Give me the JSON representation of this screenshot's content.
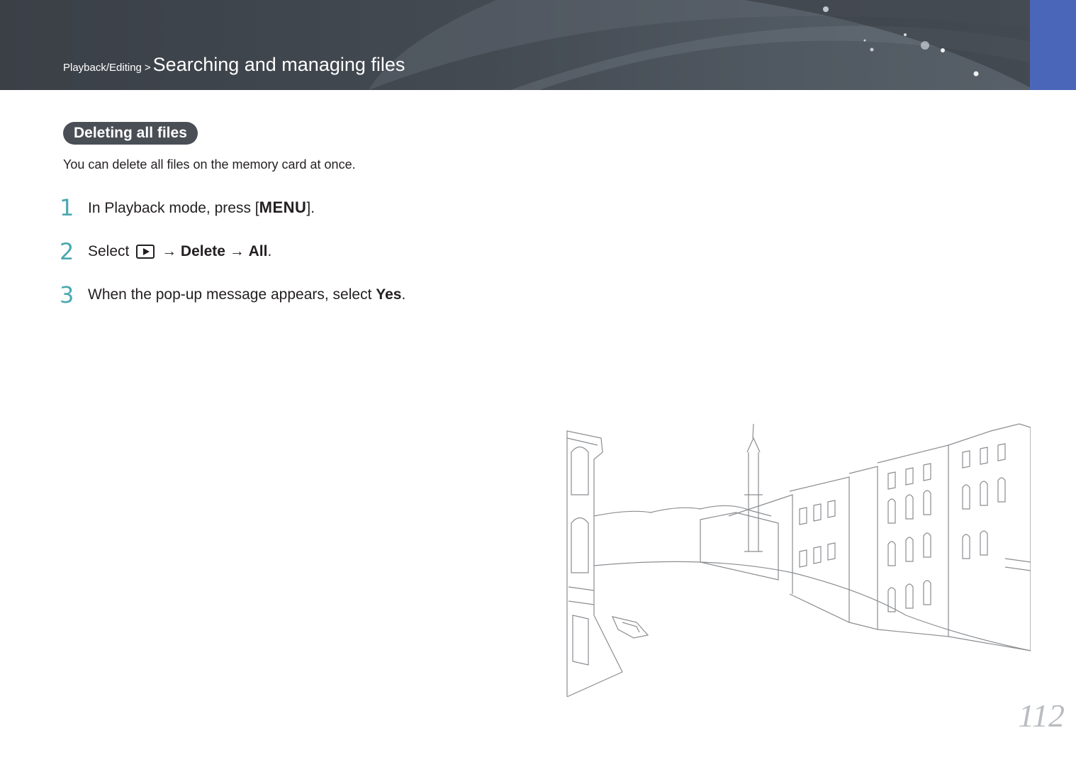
{
  "header": {
    "breadcrumb_parent": "Playback/Editing",
    "separator": ">",
    "breadcrumb_current": "Searching and managing files"
  },
  "section": {
    "title": "Deleting all files",
    "intro": "You can delete all files on the memory card at once."
  },
  "steps": [
    {
      "number": "1",
      "text_before": "In Playback mode, press [",
      "key": "MENU",
      "text_after": "]."
    },
    {
      "number": "2",
      "text_before": "Select",
      "arrow1": "→",
      "bold1": "Delete",
      "arrow2": "→",
      "bold2": "All",
      "text_after": "."
    },
    {
      "number": "3",
      "text_before": "When the pop-up message appears, select ",
      "bold": "Yes",
      "text_after": "."
    }
  ],
  "page_number": "112",
  "colors": {
    "header_bg": "#434a52",
    "header_tab": "#4a66b8",
    "pill_bg": "#4a4f56",
    "step_number": "#4aa8b0",
    "page_number": "#b9bcc0"
  },
  "icons": [
    "playback-icon"
  ]
}
